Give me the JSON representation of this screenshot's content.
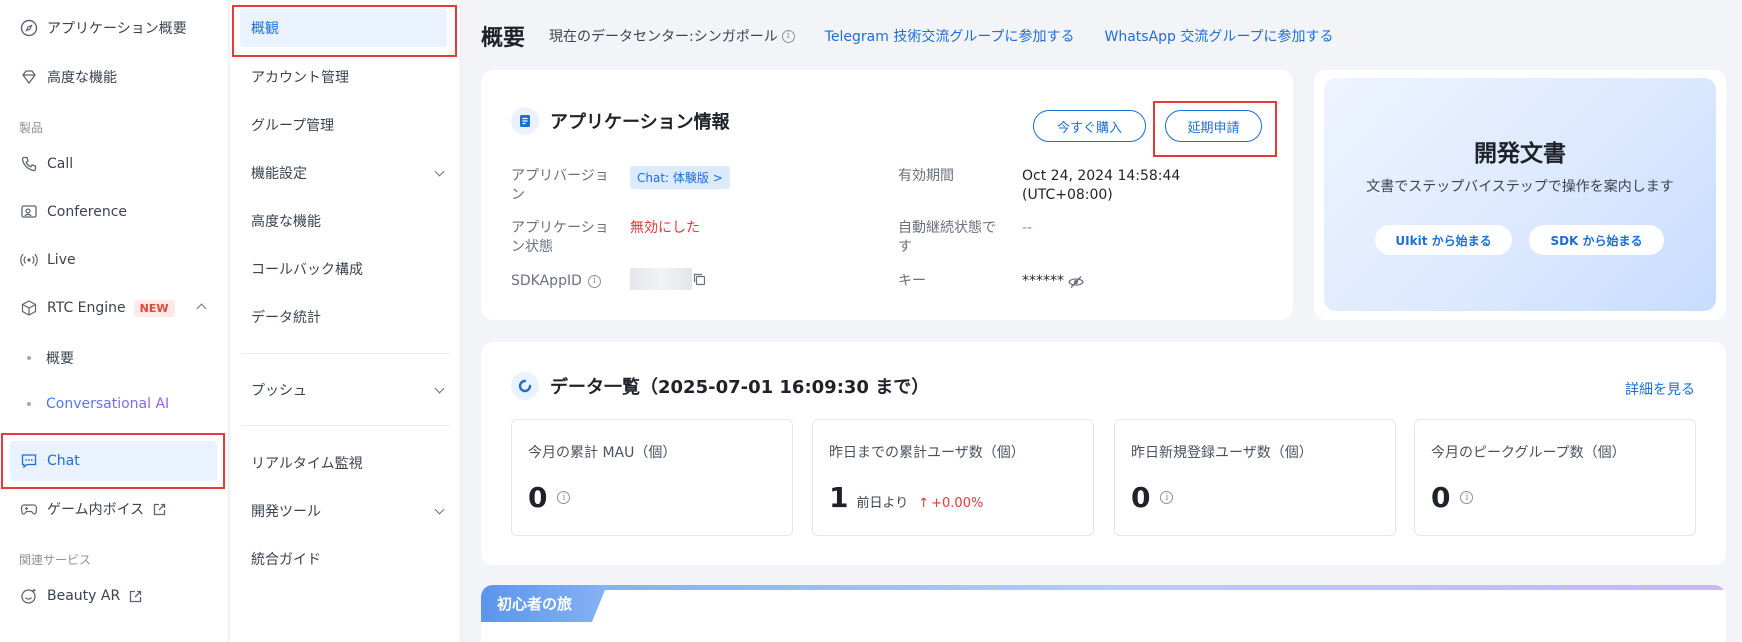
{
  "sidebar": {
    "overview": "アプリケーション概要",
    "advanced": "高度な機能",
    "section_products": "製品",
    "call": "Call",
    "conference": "Conference",
    "live": "Live",
    "rtc_engine": "RTC Engine",
    "rtc_badge": "NEW",
    "rtc_sub_overview": "概要",
    "rtc_sub_ai": "Conversational AI",
    "chat": "Chat",
    "game_voice": "ゲーム内ボイス",
    "section_related": "関連サービス",
    "beauty_ar": "Beauty AR"
  },
  "subnav": {
    "items": [
      "概観",
      "アカウント管理",
      "グループ管理",
      "機能設定",
      "高度な機能",
      "コールバック構成",
      "データ統計",
      "プッシュ",
      "リアルタイム監視",
      "開発ツール",
      "統合ガイド"
    ]
  },
  "header": {
    "title": "概要",
    "datacenter": "現在のデータセンター:シンガポール",
    "telegram_link": "Telegram 技術交流グループに参加する",
    "whatsapp_link": "WhatsApp 交流グループに参加する"
  },
  "app_info": {
    "title": "アプリケーション情報",
    "buy_button": "今すぐ購入",
    "extend_button": "延期申請",
    "version_label": "アプリバージョン",
    "version_value": "Chat: 体験版 >",
    "status_label": "アプリケーション状態",
    "status_value": "無効にした",
    "sdkappid_label": "SDKAppID",
    "validity_label": "有効期間",
    "validity_value_1": "Oct 24, 2024 14:58:44",
    "validity_value_2": "(UTC+08:00)",
    "auto_renew_label": "自動継続状態です",
    "auto_renew_value": "--",
    "key_label": "キー",
    "key_value": "******"
  },
  "docs": {
    "title": "開発文書",
    "subtitle": "文書でステップバイステップで操作を案内します",
    "uikit_button": "UIkit から始まる",
    "sdk_button": "SDK から始まる"
  },
  "data_overview": {
    "title": "データ一覧（2025-07-01 16:09:30 まで）",
    "details_link": "詳細を見る",
    "stats": [
      {
        "label": "今月の累計 MAU（個）",
        "value": "0"
      },
      {
        "label": "昨日までの累計ユーザ数（個）",
        "value": "1",
        "compare": "前日より",
        "change": "+0.00%"
      },
      {
        "label": "昨日新規登録ユーザ数（個）",
        "value": "0"
      },
      {
        "label": "今月のピークグループ数（個）",
        "value": "0"
      }
    ]
  },
  "journey": {
    "title": "初心者の旅"
  },
  "colors": {
    "accent": "#1e6ed6",
    "highlight_border": "#e5393a",
    "active_bg": "#eaf1ff"
  }
}
